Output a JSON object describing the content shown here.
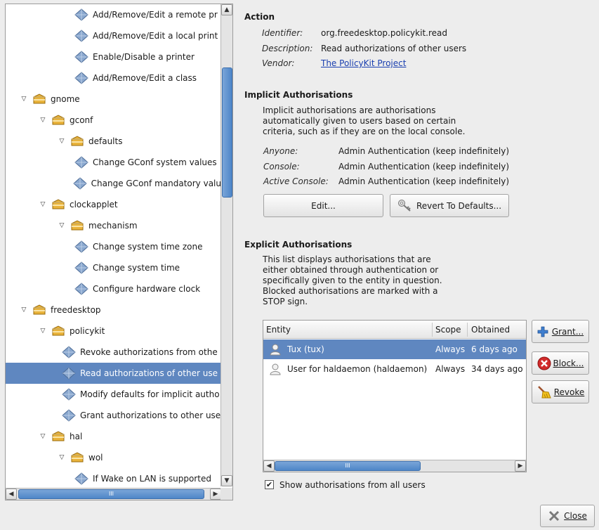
{
  "tree": {
    "rows": [
      {
        "label": "Add/Remove/Edit a remote pr",
        "level": 4,
        "kind": "action",
        "expander": ""
      },
      {
        "label": "Add/Remove/Edit a local print",
        "level": 4,
        "kind": "action",
        "expander": ""
      },
      {
        "label": "Enable/Disable a printer",
        "level": 4,
        "kind": "action",
        "expander": ""
      },
      {
        "label": "Add/Remove/Edit a class",
        "level": 4,
        "kind": "action",
        "expander": ""
      },
      {
        "label": "gnome",
        "level": 0,
        "kind": "folder",
        "expander": "▽"
      },
      {
        "label": "gconf",
        "level": 1,
        "kind": "folder",
        "expander": "▽"
      },
      {
        "label": "defaults",
        "level": 2,
        "kind": "folder",
        "expander": "▽"
      },
      {
        "label": "Change GConf system values",
        "level": 4,
        "kind": "action",
        "expander": ""
      },
      {
        "label": "Change GConf mandatory valu",
        "level": 4,
        "kind": "action",
        "expander": ""
      },
      {
        "label": "clockapplet",
        "level": 1,
        "kind": "folder",
        "expander": "▽"
      },
      {
        "label": "mechanism",
        "level": 2,
        "kind": "folder",
        "expander": "▽"
      },
      {
        "label": "Change system time zone",
        "level": 4,
        "kind": "action",
        "expander": ""
      },
      {
        "label": "Change system time",
        "level": 4,
        "kind": "action",
        "expander": ""
      },
      {
        "label": "Configure hardware clock",
        "level": 4,
        "kind": "action",
        "expander": ""
      },
      {
        "label": "freedesktop",
        "level": 0,
        "kind": "folder",
        "expander": "▽"
      },
      {
        "label": "policykit",
        "level": 1,
        "kind": "folder",
        "expander": "▽"
      },
      {
        "label": "Revoke authorizations from othe",
        "level": 3,
        "kind": "action",
        "expander": ""
      },
      {
        "label": "Read authorizations of other use",
        "level": 3,
        "kind": "action",
        "expander": "",
        "selected": true
      },
      {
        "label": "Modify defaults for implicit autho",
        "level": 3,
        "kind": "action",
        "expander": ""
      },
      {
        "label": "Grant authorizations to other use",
        "level": 3,
        "kind": "action",
        "expander": ""
      },
      {
        "label": "hal",
        "level": 1,
        "kind": "folder",
        "expander": "▽"
      },
      {
        "label": "wol",
        "level": 2,
        "kind": "folder",
        "expander": "▽"
      },
      {
        "label": "If Wake on LAN is supported",
        "level": 4,
        "kind": "action",
        "expander": ""
      }
    ],
    "hscroll_grip": "III"
  },
  "action": {
    "title": "Action",
    "identifier_label": "Identifier:",
    "identifier": "org.freedesktop.policykit.read",
    "description_label": "Description:",
    "description": "Read authorizations of other users",
    "vendor_label": "Vendor:",
    "vendor": "The PolicyKit Project"
  },
  "implicit": {
    "title": "Implicit Authorisations",
    "text_lines": [
      "Implicit authorisations are authorisations",
      "automatically given to users based on certain",
      "criteria, such as if they are on the local console."
    ],
    "rows": [
      {
        "label": "Anyone:",
        "value": "Admin Authentication (keep indefinitely)"
      },
      {
        "label": "Console:",
        "value": "Admin Authentication (keep indefinitely)"
      },
      {
        "label": "Active Console:",
        "value": "Admin Authentication (keep indefinitely)"
      }
    ],
    "edit_button": "Edit...",
    "revert_button": "Revert To Defaults..."
  },
  "explicit": {
    "title": "Explicit Authorisations",
    "text_lines": [
      "This list displays authorisations that are",
      "either obtained through authentication or",
      "specifically given to the entity in question.",
      "Blocked authorisations are marked with a",
      "STOP sign."
    ],
    "columns": [
      "Entity",
      "Scope",
      "Obtained"
    ],
    "rows": [
      {
        "entity": "Tux (tux)",
        "scope": "Always",
        "obtained": "6 days ago",
        "selected": true
      },
      {
        "entity": "User for haldaemon (haldaemon)",
        "scope": "Always",
        "obtained": "34 days ago",
        "selected": false
      }
    ],
    "hscroll_grip": "III",
    "grant_button": "Grant...",
    "block_button": "Block...",
    "revoke_button": "Revoke",
    "show_all_label": "Show authorisations from all users",
    "show_all_checked": true
  },
  "close_button": "Close",
  "colors": {
    "selection": "#5f87c0",
    "link": "#1a3fb0",
    "block_red": "#d12b2b",
    "grant_blue": "#3f7fd0"
  }
}
